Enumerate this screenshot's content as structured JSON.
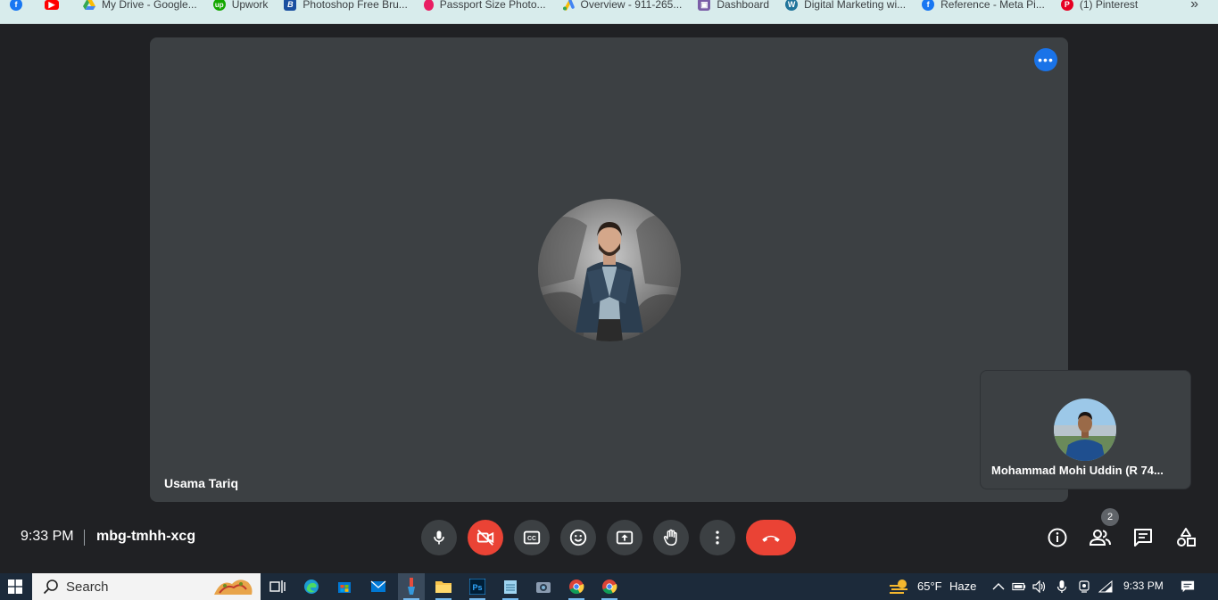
{
  "bookmarks": [
    {
      "label": "",
      "icon": "facebook-icon",
      "color": "#1877f2"
    },
    {
      "label": "",
      "icon": "youtube-icon",
      "color": "#ff0000"
    },
    {
      "label": "My Drive - Google...",
      "icon": "google-drive-icon",
      "color": "#34a853"
    },
    {
      "label": "Upwork",
      "icon": "upwork-icon",
      "color": "#14a800"
    },
    {
      "label": "Photoshop Free Bru...",
      "icon": "brushes-site-icon",
      "color": "#1a4fa0"
    },
    {
      "label": "Passport Size Photo...",
      "icon": "passport-photo-icon",
      "color": "#e91e63"
    },
    {
      "label": "Overview - 911-265...",
      "icon": "google-ads-icon",
      "color": "#fbbc04"
    },
    {
      "label": "Dashboard",
      "icon": "dashboard-icon",
      "color": "#7b5ea7"
    },
    {
      "label": "Digital Marketing wi...",
      "icon": "wordpress-icon",
      "color": "#21759b"
    },
    {
      "label": "Reference - Meta Pi...",
      "icon": "meta-icon",
      "color": "#1877f2"
    },
    {
      "label": "(1) Pinterest",
      "icon": "pinterest-icon",
      "color": "#e60023"
    }
  ],
  "bookmarks_more": "»",
  "meeting": {
    "main_participant": "Usama Tariq",
    "self_participant": "Mohammad Mohi Uddin (R 74...",
    "time": "9:33 PM",
    "code": "mbg-tmhh-xcg",
    "people_count": "2"
  },
  "taskbar": {
    "search_placeholder": "Search",
    "weather_temp": "65°F",
    "weather_desc": "Haze",
    "clock": "9:33 PM"
  },
  "colors": {
    "background": "#202124",
    "tile": "#3c4043",
    "accent_blue": "#1a73e8",
    "danger_red": "#ea4335",
    "taskbar": "#1c2a3a"
  }
}
